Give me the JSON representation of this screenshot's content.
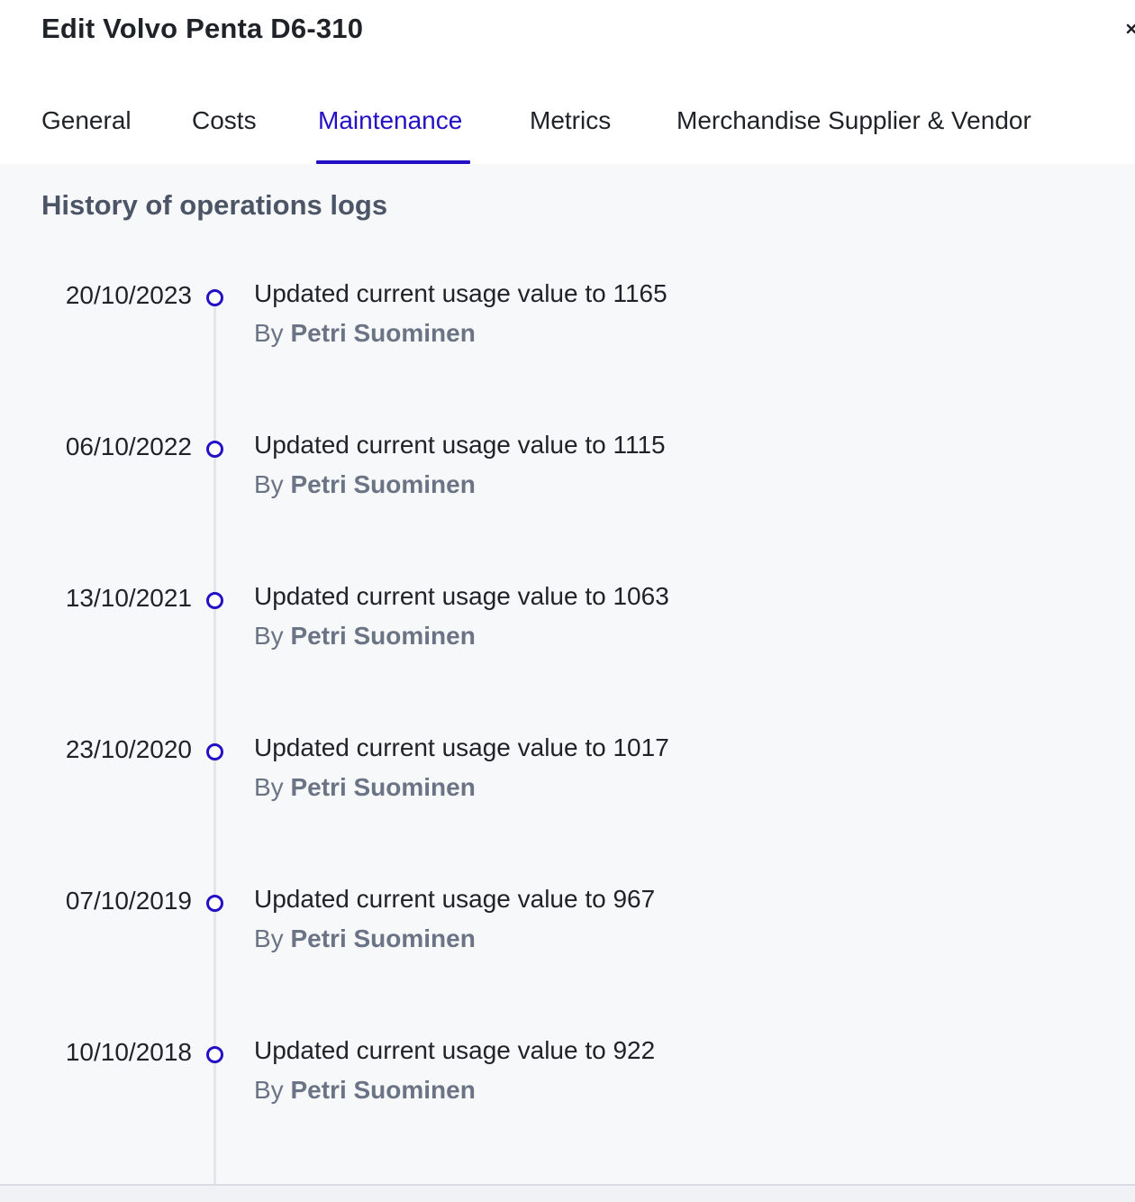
{
  "header": {
    "title": "Edit Volvo Penta D6-310"
  },
  "tabs": [
    {
      "label": "General",
      "active": false
    },
    {
      "label": "Costs",
      "active": false
    },
    {
      "label": "Maintenance",
      "active": true
    },
    {
      "label": "Metrics",
      "active": false
    },
    {
      "label": "Merchandise Supplier & Vendor",
      "active": false
    }
  ],
  "section": {
    "title": "History of operations logs"
  },
  "logs": [
    {
      "date": "20/10/2023",
      "text": "Updated current usage value to 1165",
      "by_prefix": "By",
      "author": "Petri Suominen"
    },
    {
      "date": "06/10/2022",
      "text": "Updated current usage value to 1115",
      "by_prefix": "By",
      "author": "Petri Suominen"
    },
    {
      "date": "13/10/2021",
      "text": "Updated current usage value to 1063",
      "by_prefix": "By",
      "author": "Petri Suominen"
    },
    {
      "date": "23/10/2020",
      "text": "Updated current usage value to 1017",
      "by_prefix": "By",
      "author": "Petri Suominen"
    },
    {
      "date": "07/10/2019",
      "text": "Updated current usage value to 967",
      "by_prefix": "By",
      "author": "Petri Suominen"
    },
    {
      "date": "10/10/2018",
      "text": "Updated current usage value to 922",
      "by_prefix": "By",
      "author": "Petri Suominen"
    }
  ],
  "colors": {
    "accent": "#2310c4",
    "text": "#1f2328",
    "muted": "#6b7485",
    "section_title": "#4b5566",
    "content_bg": "#f7f8fa"
  }
}
